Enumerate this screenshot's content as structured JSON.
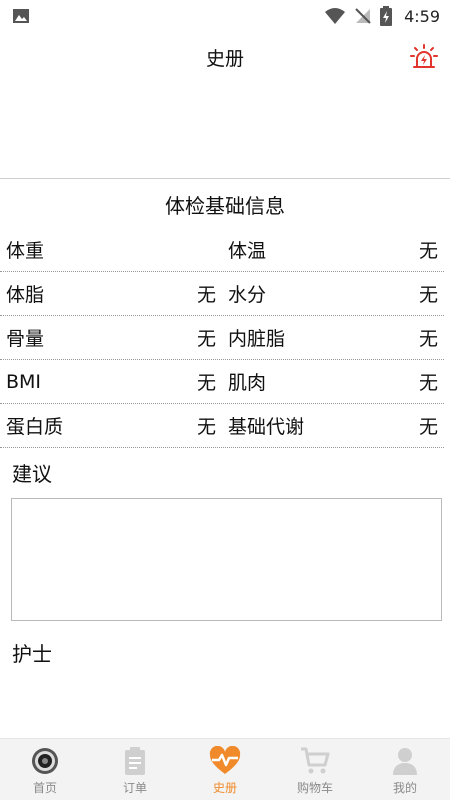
{
  "status_bar": {
    "time": "4:59"
  },
  "header": {
    "title": "史册"
  },
  "section": {
    "title": "体检基础信息"
  },
  "rows": [
    {
      "left_label": "体重",
      "left_value": "",
      "right_label": "体温",
      "right_value": "无"
    },
    {
      "left_label": "体脂",
      "left_value": "无",
      "right_label": "水分",
      "right_value": "无"
    },
    {
      "left_label": "骨量",
      "left_value": "无",
      "right_label": "内脏脂",
      "right_value": "无"
    },
    {
      "left_label": "BMI",
      "left_value": "无",
      "right_label": "肌肉",
      "right_value": "无"
    },
    {
      "left_label": "蛋白质",
      "left_value": "无",
      "right_label": "基础代谢",
      "right_value": "无"
    }
  ],
  "advice": {
    "label": "建议",
    "value": ""
  },
  "nurse": {
    "label": "护士"
  },
  "nav": {
    "items": [
      {
        "label": "首页",
        "icon": "home-icon",
        "active": false
      },
      {
        "label": "订单",
        "icon": "clipboard-icon",
        "active": false
      },
      {
        "label": "史册",
        "icon": "heart-pulse-icon",
        "active": true
      },
      {
        "label": "购物车",
        "icon": "cart-icon",
        "active": false
      },
      {
        "label": "我的",
        "icon": "user-icon",
        "active": false
      }
    ],
    "active_color": "#f08a2a",
    "inactive_color": "#cfcfcf"
  },
  "colors": {
    "alarm": "#e0342c"
  }
}
